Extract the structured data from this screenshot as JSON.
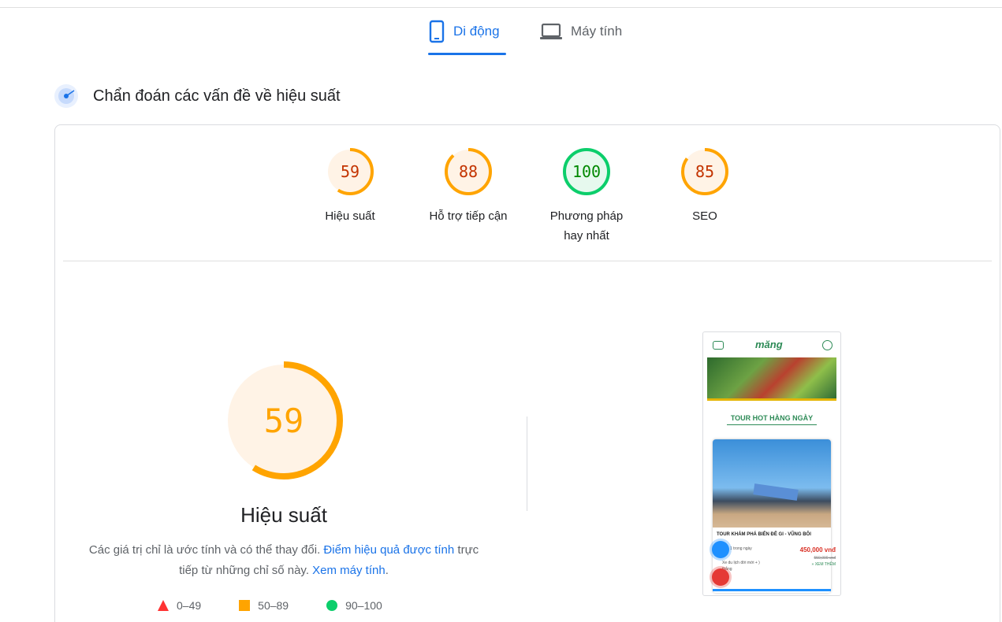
{
  "tabs": {
    "mobile": "Di động",
    "desktop": "Máy tính"
  },
  "section": {
    "title": "Chẩn đoán các vấn đề về hiệu suất"
  },
  "scores": [
    {
      "value": "59",
      "label": "Hiệu suất",
      "score": 59,
      "status": "average"
    },
    {
      "value": "88",
      "label": "Hỗ trợ tiếp cận",
      "score": 88,
      "status": "average"
    },
    {
      "value": "100",
      "label": "Phương pháp hay nhất",
      "score": 100,
      "status": "pass"
    },
    {
      "value": "85",
      "label": "SEO",
      "score": 85,
      "status": "average"
    }
  ],
  "main": {
    "score": "59",
    "score_value": 59,
    "title": "Hiệu suất",
    "desc_prefix": "Các giá trị chỉ là ước tính và có thể thay đổi. ",
    "desc_link1": "Điểm hiệu quả được tính",
    "desc_middle": " trực tiếp từ những chỉ số này. ",
    "desc_link2": "Xem máy tính",
    "desc_suffix": "."
  },
  "legend": {
    "fail": "0–49",
    "average": "50–89",
    "pass": "90–100"
  },
  "colors": {
    "accent": "#1a73e8",
    "average": "#ffa400",
    "average_text": "#c33300",
    "average_bg": "#fff3e6",
    "pass": "#0cce6b",
    "pass_text": "#008800",
    "pass_bg": "#e6f9ee",
    "fail": "#ff3333"
  },
  "phone_preview": {
    "logo": "măng",
    "hot_title": "TOUR HOT HÀNG NGÀY",
    "tour_title": "TOUR KHÁM PHÁ BIỂN ĐÊ GI - VŨNG BÔI",
    "price": "450,000 vnđ",
    "old_price": "550,000 vnđ",
    "more": "» XEM THÊM",
    "meta1": "1 trong ngày",
    "meta2": "Xe du lịch đời mới + )",
    "meta3": "thắng"
  }
}
